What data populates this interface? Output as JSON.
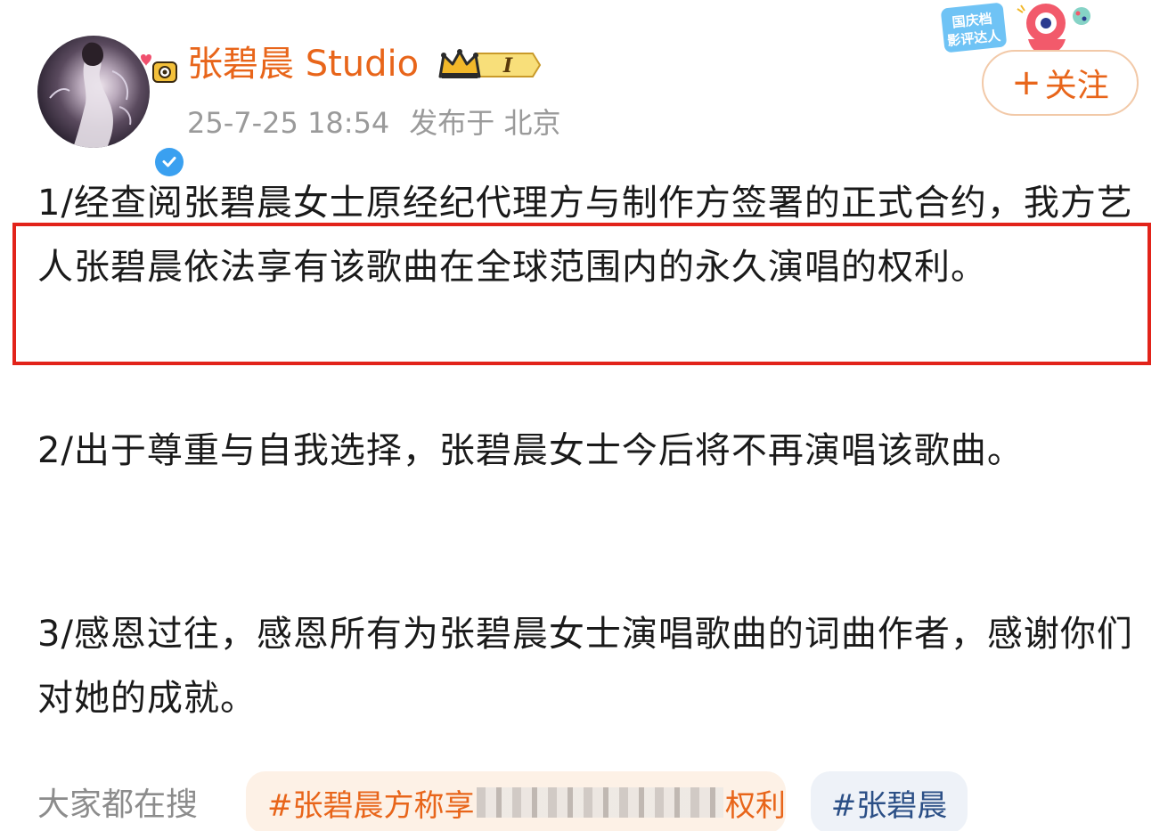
{
  "post": {
    "author": "张碧晨 Studio",
    "timestamp": "25-7-25 18:54",
    "location": "发布于 北京",
    "follow_label": "关注",
    "follow_plus": "+",
    "level_badge": "I",
    "festival_badge": "国庆档影评达人",
    "paragraphs": {
      "p1": "1/经查阅张碧晨女士原经纪代理方与制作方签署的正式合约，我方艺人张碧晨依法享有该歌曲在全球范围内的永久演唱的权利。",
      "p2": "2/出于尊重与自我选择，张碧晨女士今后将不再演唱该歌曲。",
      "p3": "3/感恩过往，感恩所有为张碧晨女士演唱歌曲的词曲作者，感谢你们对她的成就。"
    }
  },
  "search": {
    "label": "大家都在搜",
    "tag1_start": "#张碧晨方称享",
    "tag1_end": "权利",
    "tag2": "#张碧晨"
  },
  "colors": {
    "accent": "#e8651a",
    "verified": "#3aa0f0",
    "highlight": "#e2231a",
    "meta": "#9a9a9a"
  },
  "icons": [
    "verified-icon",
    "crown-icon",
    "plus-icon",
    "festival-mascot-icon",
    "camera-sticker-icon"
  ]
}
